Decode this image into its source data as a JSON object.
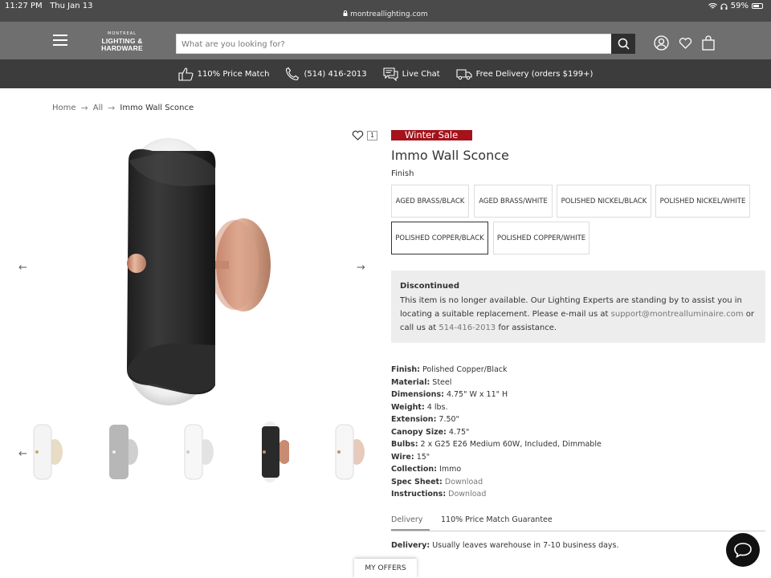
{
  "status": {
    "time": "11:27 PM",
    "date": "Thu Jan 13",
    "url": "montreallighting.com",
    "battery": "59%"
  },
  "header": {
    "logo_small": "MONTREAL",
    "logo_main": "LIGHTING & HARDWARE",
    "search_placeholder": "What are you looking for?"
  },
  "promos": [
    {
      "icon": "thumbs-up-icon",
      "label": "110% Price Match"
    },
    {
      "icon": "phone-icon",
      "label": "(514) 416-2013"
    },
    {
      "icon": "chat-icon",
      "label": "Live Chat"
    },
    {
      "icon": "truck-icon",
      "label": "Free Delivery (orders $199+)"
    }
  ],
  "breadcrumb": [
    "Home",
    "All",
    "Immo Wall Sconce"
  ],
  "wishlist_count": "1",
  "product": {
    "badge": "Winter Sale",
    "title": "Immo Wall Sconce",
    "finish_label": "Finish",
    "finishes": [
      "AGED BRASS/BLACK",
      "AGED BRASS/WHITE",
      "POLISHED NICKEL/BLACK",
      "POLISHED NICKEL/WHITE",
      "POLISHED COPPER/BLACK",
      "POLISHED COPPER/WHITE"
    ],
    "selected_finish": "POLISHED COPPER/BLACK"
  },
  "notice": {
    "title": "Discontinued",
    "text1": "This item is no longer available. Our Lighting Experts are standing by to assist you in locating a suitable replacement. Please e-mail us at",
    "email": "support@montrealluminaire.com",
    "text2": "or call us at",
    "phone": "514-416-2013",
    "text3": "for assistance."
  },
  "specs": [
    {
      "key": "Finish:",
      "value": "Polished Copper/Black"
    },
    {
      "key": "Material:",
      "value": "Steel"
    },
    {
      "key": "Dimensions:",
      "value": "4.75\" W x 11\" H"
    },
    {
      "key": "Weight:",
      "value": "4 lbs."
    },
    {
      "key": "Extension:",
      "value": "7.50\""
    },
    {
      "key": "Canopy Size:",
      "value": "4.75\""
    },
    {
      "key": "Bulbs:",
      "value": "2 x G25 E26 Medium 60W, Included, Dimmable"
    },
    {
      "key": "Wire:",
      "value": "15\""
    },
    {
      "key": "Collection:",
      "value": "Immo"
    },
    {
      "key": "Spec Sheet:",
      "value": "Download",
      "link": true
    },
    {
      "key": "Instructions:",
      "value": "Download",
      "link": true
    }
  ],
  "tabs": [
    "Delivery",
    "110% Price Match Guarantee"
  ],
  "delivery": {
    "label": "Delivery:",
    "text": "Usually leaves warehouse in 7-10 business days."
  },
  "my_offers": "MY OFFERS",
  "thumb_finishes": [
    "white-brass",
    "silver-white",
    "white",
    "black-copper",
    "white-copper"
  ],
  "colors": {
    "sale": "#a5121b",
    "header": "#6f6f6f",
    "promo_bar": "#3c3c3c",
    "copper": "#c98b72"
  }
}
